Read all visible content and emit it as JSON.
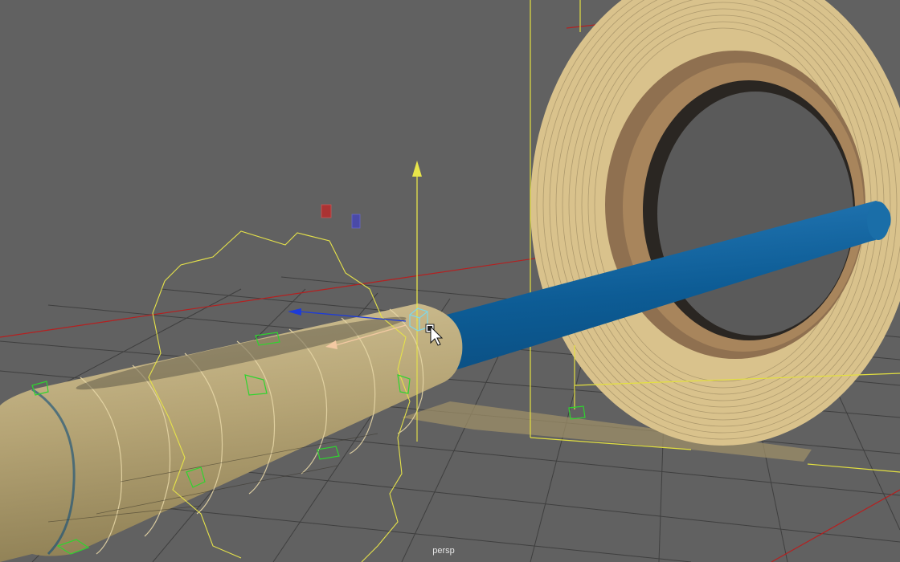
{
  "viewport": {
    "camera_name": "persp",
    "background": "#616161",
    "grid_color": "#3e3e3e",
    "axis_color": "#b41e1e"
  },
  "colors": {
    "pipe": "#0d5c95",
    "pipe_highlight": "#2b7fbd",
    "wrap_tape": "#b8a779",
    "wrap_tape_light": "#cdbd8f",
    "tape_roll_outer": "#d8c08a",
    "tape_roll_inner": "#8a6d4d",
    "selection": "#e8e54a",
    "control_vertex": "#27d127",
    "manip_y": "#e8e54a",
    "manip_x": "#1e3cd8",
    "manip_z": "#f3c9a3"
  },
  "icons": {
    "manipulator_center": "cube-handle-icon",
    "cursor": "arrow-cursor-icon"
  }
}
